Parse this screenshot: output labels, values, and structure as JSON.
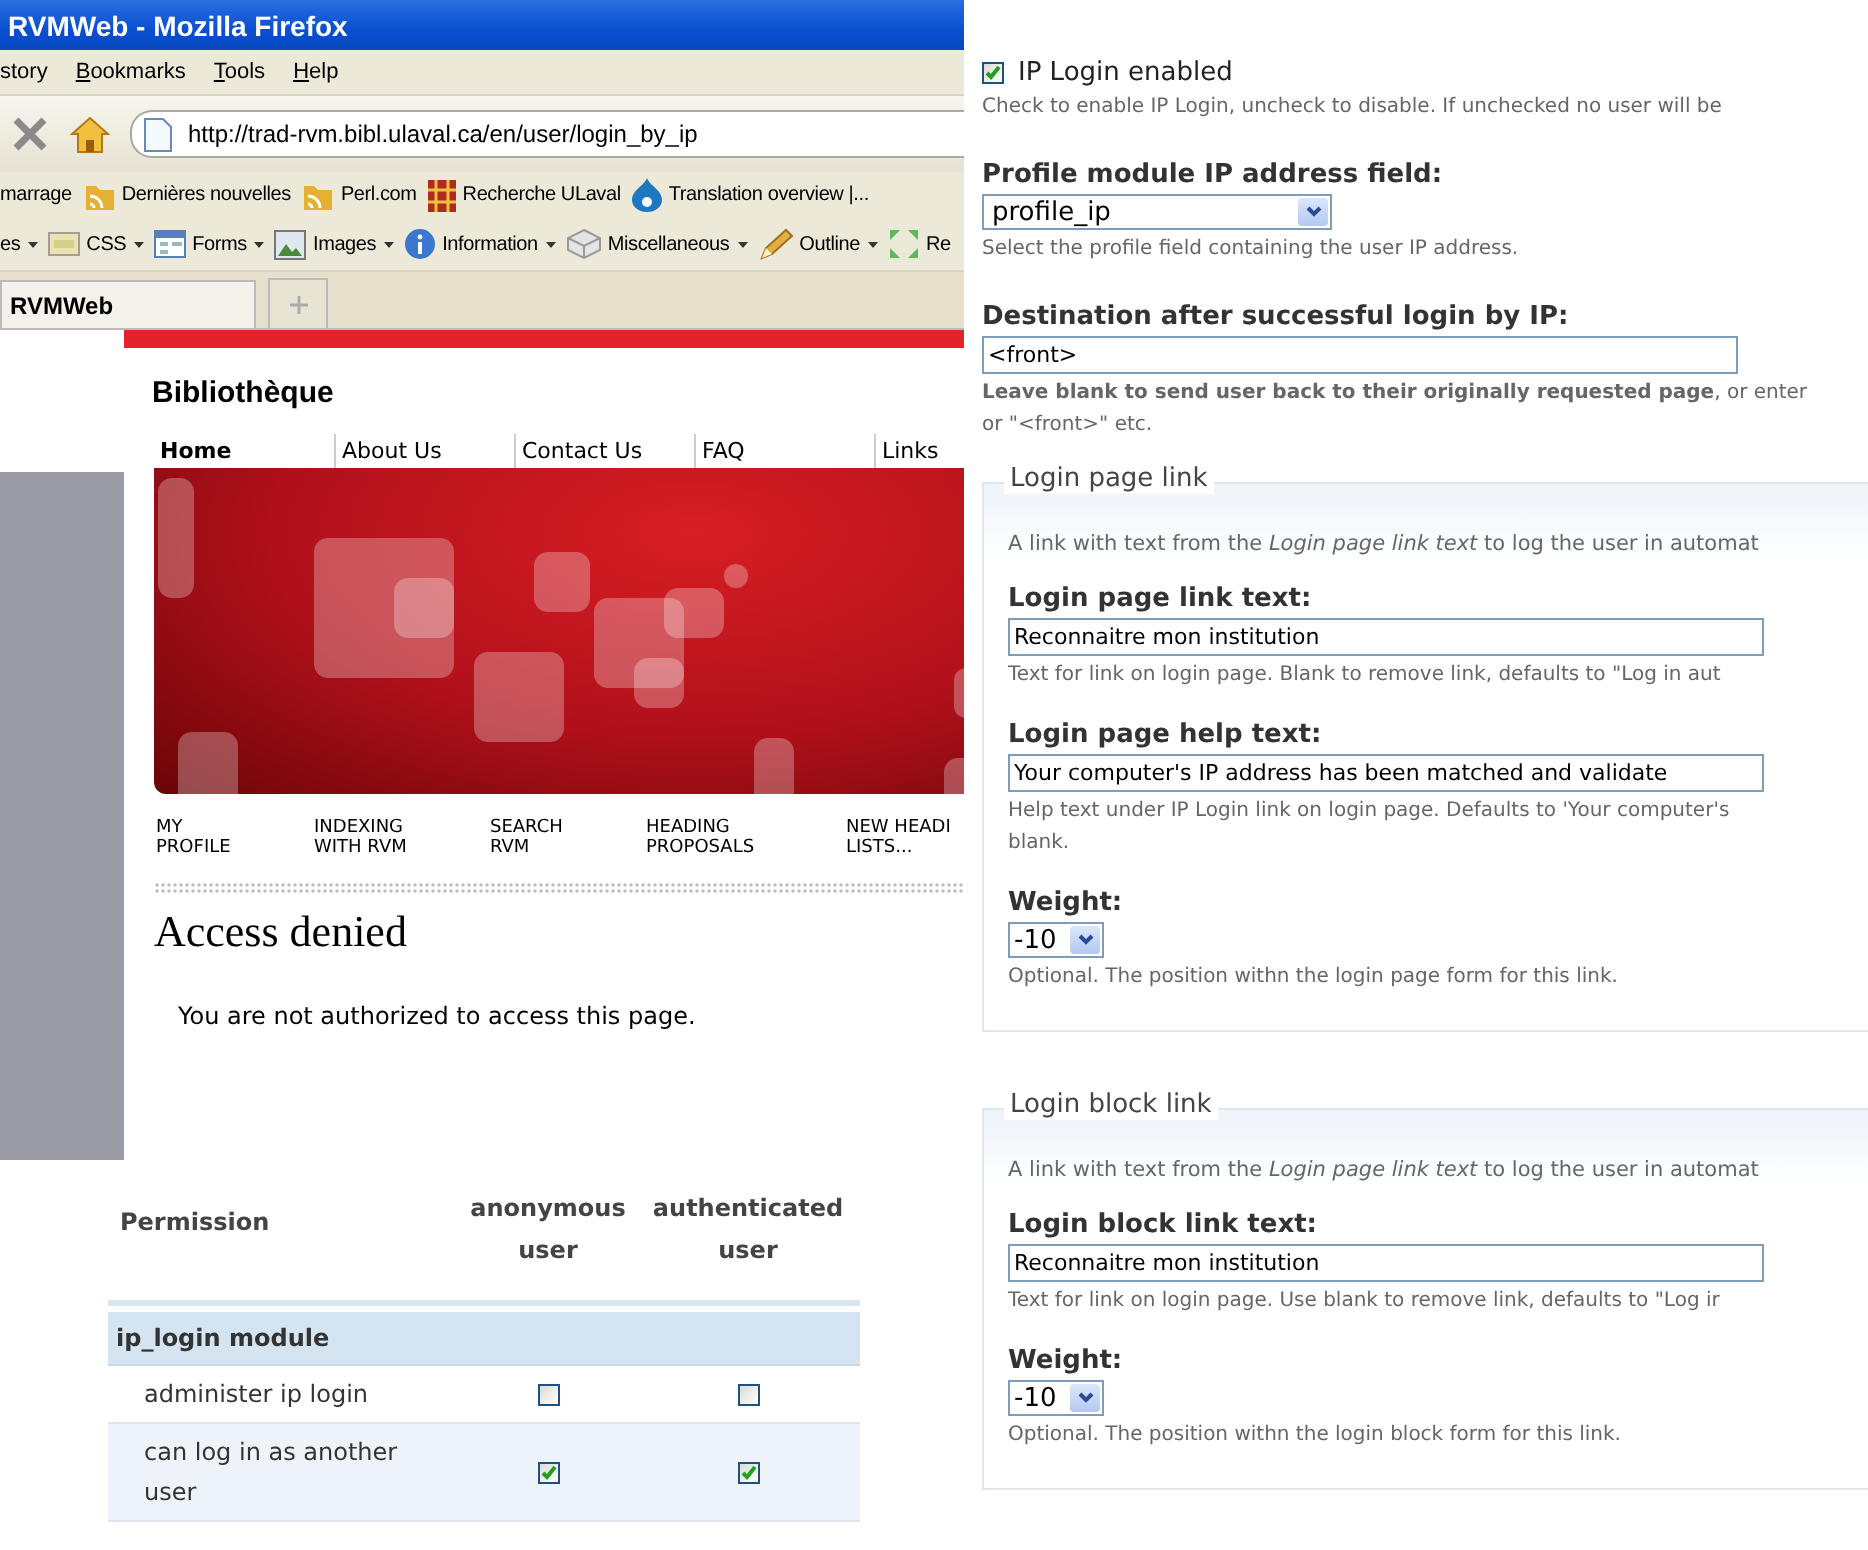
{
  "browser": {
    "title": "RVMWeb - Mozilla Firefox",
    "menu": [
      {
        "label": "story",
        "accel": false
      },
      {
        "label": "Bookmarks",
        "accel": true
      },
      {
        "label": "Tools",
        "accel": true
      },
      {
        "label": "Help",
        "accel": true
      }
    ],
    "url": "http://trad-rvm.bibl.ulaval.ca/en/user/login_by_ip",
    "bookmarks": [
      {
        "label": "marrage",
        "kind": "none"
      },
      {
        "label": "Dernières nouvelles",
        "kind": "feed"
      },
      {
        "label": "Perl.com",
        "kind": "feed"
      },
      {
        "label": "Recherche ULaval",
        "kind": "grid"
      },
      {
        "label": "Translation overview |...",
        "kind": "drop"
      }
    ],
    "dev_toolbar": [
      {
        "label": "es",
        "kind": "none",
        "menu": true
      },
      {
        "label": "CSS",
        "kind": "css",
        "menu": true
      },
      {
        "label": "Forms",
        "kind": "form",
        "menu": true
      },
      {
        "label": "Images",
        "kind": "image",
        "menu": true
      },
      {
        "label": "Information",
        "kind": "info",
        "menu": true
      },
      {
        "label": "Miscellaneous",
        "kind": "cube",
        "menu": true
      },
      {
        "label": "Outline",
        "kind": "pencil",
        "menu": true
      },
      {
        "label": "Re",
        "kind": "resize",
        "menu": false
      }
    ],
    "tabs": [
      {
        "label": "RVMWeb",
        "selected": true
      }
    ]
  },
  "site": {
    "name": "Bibliothèque",
    "nav": [
      {
        "label": "Home",
        "selected": true
      },
      {
        "label": "About Us",
        "selected": false
      },
      {
        "label": "Contact Us",
        "selected": false
      },
      {
        "label": "FAQ",
        "selected": false
      },
      {
        "label": "Links",
        "selected": false
      }
    ],
    "subnav": [
      "MY\nPROFILE",
      "INDEXING\nWITH RVM",
      "SEARCH\nRVM",
      "HEADING\nPROPOSALS",
      "NEW HEADI\nLISTS..."
    ],
    "heading": "Access denied",
    "message": "You are not authorized to access this page."
  },
  "permissions": {
    "columns": [
      "Permission",
      "anonymous\nuser",
      "authenticated\nuser"
    ],
    "section": "ip_login module",
    "rows": [
      {
        "name": "administer ip login",
        "anonymous": false,
        "authenticated": false
      },
      {
        "name": "can log in as another\nuser",
        "anonymous": true,
        "authenticated": true
      }
    ]
  },
  "settings": {
    "enabled": {
      "label": "IP Login enabled",
      "checked": true,
      "description": "Check to enable IP Login, uncheck to disable. If unchecked no user will be"
    },
    "fields": [
      {
        "kind": "select",
        "label": "Profile module IP address field:",
        "value": "profile_ip",
        "description": [
          "Select the profile field containing the user IP address."
        ]
      },
      {
        "kind": "text",
        "label": "Destination after successful login by IP:",
        "value": "<front>",
        "description": [
          "**Leave blank to send user back to their originally requested page**, or enter",
          "or \"<front>\" etc."
        ]
      }
    ],
    "fieldsets": [
      {
        "legend": "Login page link",
        "description": "A link with text from the *Login page link text* to log the user in automat",
        "fields": [
          {
            "kind": "text",
            "label": "Login page link text:",
            "value": "Reconnaitre mon institution",
            "description": [
              "Text for link on login page. Blank to remove link, defaults to \"Log in aut"
            ]
          },
          {
            "kind": "text",
            "label": "Login page help text:",
            "value": "Your computer's IP address has been matched and validate",
            "description": [
              "Help text under IP Login link on login page. Defaults to 'Your computer's",
              "blank."
            ]
          },
          {
            "kind": "weight",
            "label": "Weight:",
            "value": "-10",
            "description": [
              "Optional. The position withn the login page form for this link."
            ]
          }
        ]
      },
      {
        "legend": "Login block link",
        "description": "A link with text from the *Login page link text* to log the user in automat",
        "fields": [
          {
            "kind": "text",
            "label": "Login block link text:",
            "value": "Reconnaitre mon institution",
            "description": [
              "Text for link on login page. Use blank to remove link, defaults to \"Log ir"
            ]
          },
          {
            "kind": "weight",
            "label": "Weight:",
            "value": "-10",
            "description": [
              "Optional. The position withn the login block form for this link."
            ]
          }
        ]
      }
    ]
  }
}
